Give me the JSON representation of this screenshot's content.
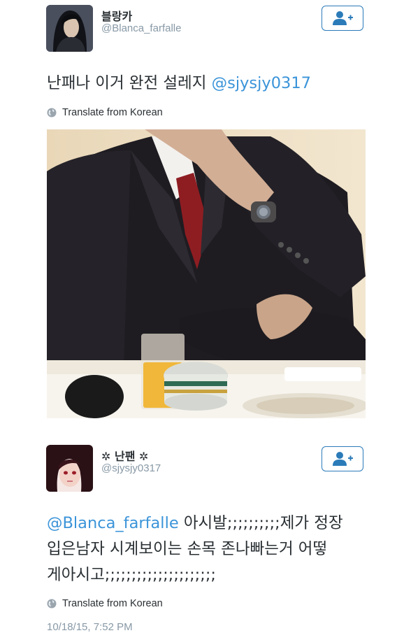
{
  "tweet1": {
    "author_name": "블랑카",
    "author_handle": "@Blanca_farfalle",
    "text": "난패나 이거 완전 설레지 ",
    "mention": "@sjysjy0317",
    "translate_label": "Translate from Korean"
  },
  "tweet2": {
    "author_name": "✲ 난팬 ✲",
    "author_handle": "@sjysjy0317",
    "mention": "@Blanca_farfalle",
    "line1_text": " 아시발;;;;;;;;;;제가 정장",
    "line2_text": "입은남자 시계보이는 손목 존나빠는거 어떻",
    "line3_text": "게아시고;;;;;;;;;;;;;;;;;;;;;",
    "translate_label": "Translate from Korean",
    "timestamp": "10/18/15, 7:52 PM"
  },
  "icons": {
    "follow": "add-user-icon",
    "translate": "globe-icon"
  },
  "colors": {
    "link": "#3b94d9",
    "follow_border": "#2b7bb9",
    "muted": "#8899a6",
    "text": "#292f33"
  }
}
